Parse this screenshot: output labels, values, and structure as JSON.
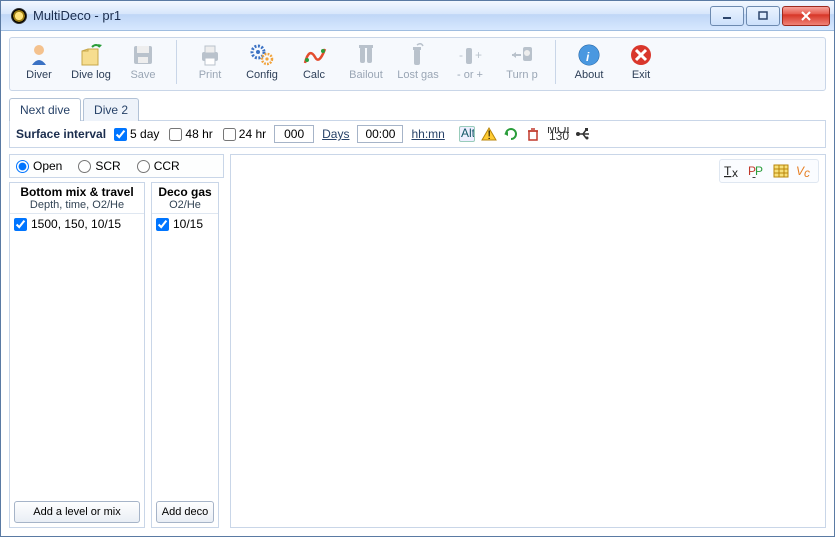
{
  "window_title": "MultiDeco - pr1",
  "toolbar": [
    {
      "label": "Diver",
      "icon": "diver",
      "enabled": true
    },
    {
      "label": "Dive log",
      "icon": "divelog",
      "enabled": true
    },
    {
      "label": "Save",
      "icon": "save",
      "enabled": false
    },
    {
      "sep": true
    },
    {
      "label": "Print",
      "icon": "print",
      "enabled": false
    },
    {
      "label": "Config",
      "icon": "config",
      "enabled": true
    },
    {
      "label": "Calc",
      "icon": "calc",
      "enabled": true
    },
    {
      "label": "Bailout",
      "icon": "bailout",
      "enabled": false
    },
    {
      "label": "Lost gas",
      "icon": "lostgas",
      "enabled": false
    },
    {
      "label": "- or +",
      "icon": "minusplus",
      "enabled": false
    },
    {
      "label": "Turn p",
      "icon": "turnp",
      "enabled": false
    },
    {
      "sep": true
    },
    {
      "label": "About",
      "icon": "about",
      "enabled": true
    },
    {
      "label": "Exit",
      "icon": "exit",
      "enabled": true
    }
  ],
  "tabs": [
    {
      "label": "Next dive",
      "active": true
    },
    {
      "label": "Dive 2",
      "active": false
    }
  ],
  "surface": {
    "label": "Surface interval",
    "opts": [
      {
        "label": "5 day",
        "checked": true
      },
      {
        "label": "48 hr",
        "checked": false
      },
      {
        "label": "24 hr",
        "checked": false
      }
    ],
    "days_value": "000",
    "days_label": "Days",
    "time_value": "00:00",
    "time_label": "hh:mn"
  },
  "modes": [
    {
      "label": "Open",
      "checked": true
    },
    {
      "label": "SCR",
      "checked": false
    },
    {
      "label": "CCR",
      "checked": false
    }
  ],
  "panels": {
    "bottom": {
      "title": "Bottom mix & travel",
      "subtitle": "Depth, time, O2/He",
      "items": [
        {
          "text": "1500, 150, 10/15",
          "checked": true
        }
      ],
      "add_label": "Add a level or mix"
    },
    "deco": {
      "title": "Deco gas",
      "subtitle": "O2/He",
      "items": [
        {
          "text": "10/15",
          "checked": true
        }
      ],
      "add_label": "Add deco"
    }
  },
  "right_tools": [
    "Tx",
    "PP",
    "grid",
    "Vc"
  ]
}
